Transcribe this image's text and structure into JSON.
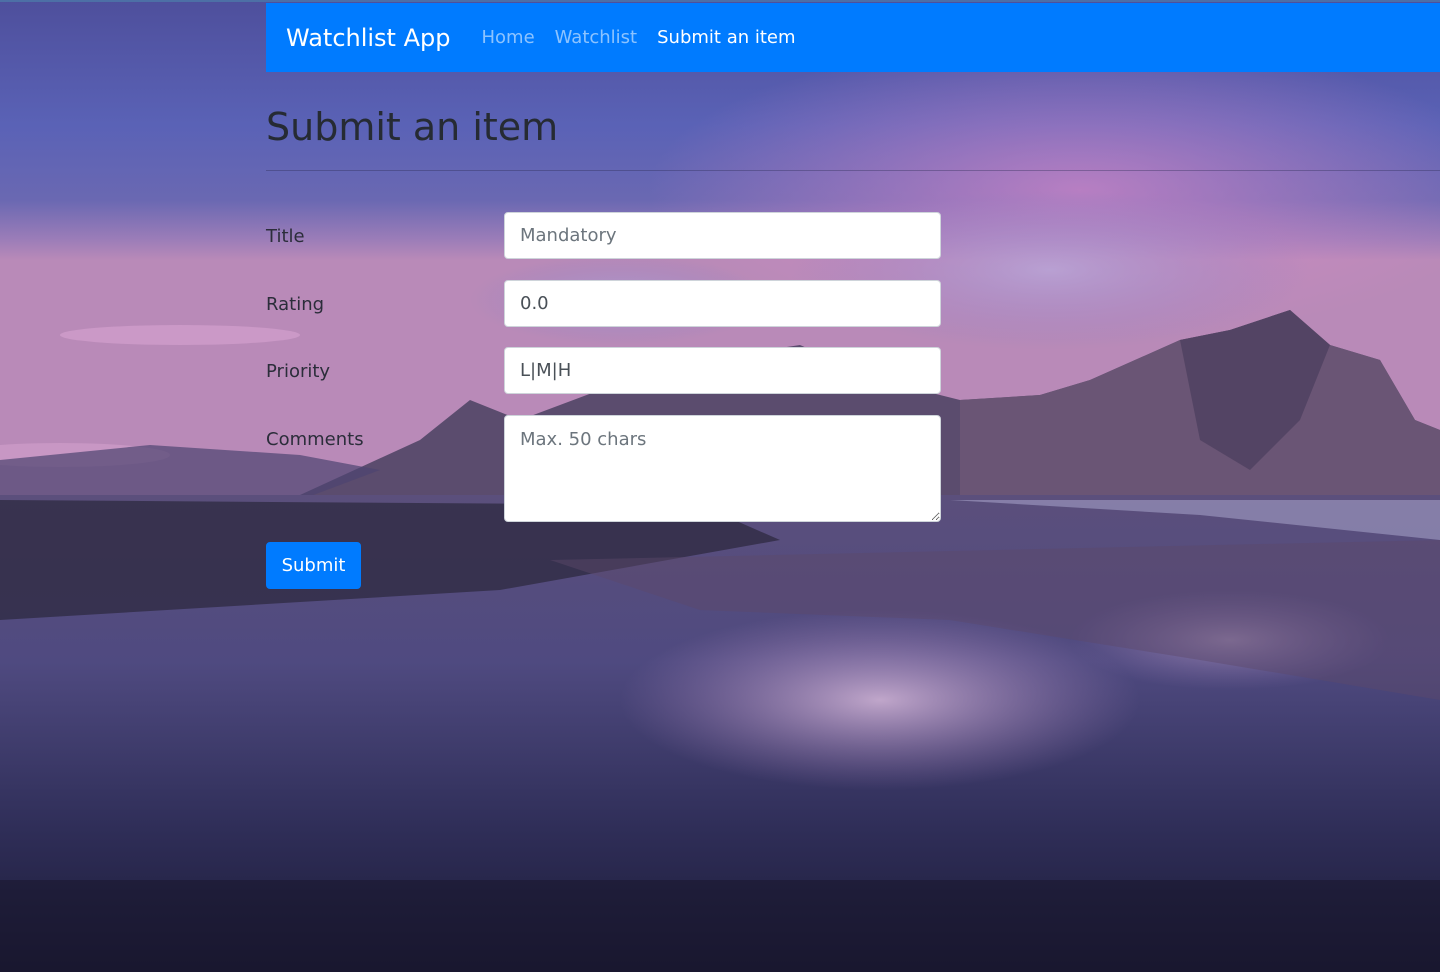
{
  "navbar": {
    "brand": "Watchlist App",
    "links": [
      {
        "label": "Home",
        "active": false
      },
      {
        "label": "Watchlist",
        "active": false
      },
      {
        "label": "Submit an item",
        "active": true
      }
    ],
    "color": "#007bff"
  },
  "page": {
    "title": "Submit an item"
  },
  "form": {
    "title": {
      "label": "Title",
      "placeholder": "Mandatory",
      "value": ""
    },
    "rating": {
      "label": "Rating",
      "placeholder": "",
      "value": "0.0"
    },
    "priority": {
      "label": "Priority",
      "placeholder": "",
      "value": "L|M|H"
    },
    "comments": {
      "label": "Comments",
      "placeholder": "Max. 50 chars",
      "value": ""
    },
    "submit_label": "Submit"
  },
  "icons": {
    "resize": "resize-grip-icon"
  }
}
